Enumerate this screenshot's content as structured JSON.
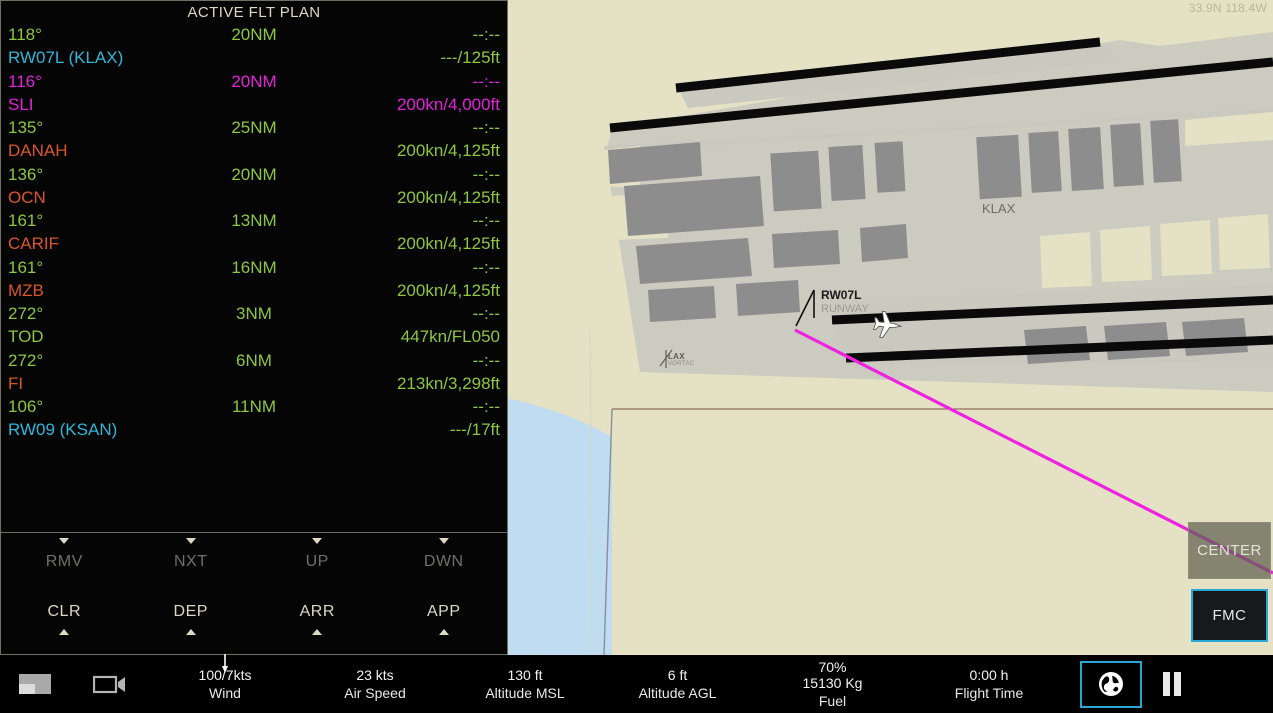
{
  "map": {
    "coordinates": "33.9N 118.4W",
    "labels": {
      "airport": "KLAX",
      "runway_id": "RW07L",
      "runway_sub": "RUNWAY",
      "navaid": "LAX",
      "navaid_sub": "VORTAC"
    },
    "colors": {
      "land": "#e4e1c4",
      "water": "#bfdcf0",
      "runway": "#0a0a0a",
      "apron": "#c9c9c0",
      "building": "#8d8d8d",
      "course_line": "#ee22e0",
      "border_line": "#6b4a3a"
    },
    "buttons": {
      "center": "CENTER",
      "fmc": "FMC"
    }
  },
  "flight_plan": {
    "title": "ACTIVE FLT PLAN",
    "colors": {
      "green": "#8dc63f",
      "cyan": "#2fb6d8",
      "magenta": "#e224d8",
      "orange": "#d8562a",
      "cream": "#ded8c4",
      "dim": "#6f6f6d"
    },
    "legs": [
      {
        "course": "118°",
        "distance": "20NM",
        "eta": "--:--",
        "name": "RW07L (KLAX)",
        "speed_alt": "---/125ft",
        "course_color": "green",
        "dist_color": "green",
        "eta_color": "green",
        "name_color": "cyan",
        "speed_color": "green"
      },
      {
        "course": "116°",
        "distance": "20NM",
        "eta": "--:--",
        "name": "SLI",
        "speed_alt": "200kn/4,000ft",
        "course_color": "magenta",
        "dist_color": "magenta",
        "eta_color": "magenta",
        "name_color": "magenta",
        "speed_color": "magenta"
      },
      {
        "course": "135°",
        "distance": "25NM",
        "eta": "--:--",
        "name": "DANAH",
        "speed_alt": "200kn/4,125ft",
        "course_color": "green",
        "dist_color": "green",
        "eta_color": "green",
        "name_color": "orange",
        "speed_color": "green"
      },
      {
        "course": "136°",
        "distance": "20NM",
        "eta": "--:--",
        "name": "OCN",
        "speed_alt": "200kn/4,125ft",
        "course_color": "green",
        "dist_color": "green",
        "eta_color": "green",
        "name_color": "orange",
        "speed_color": "green"
      },
      {
        "course": "161°",
        "distance": "13NM",
        "eta": "--:--",
        "name": "CARIF",
        "speed_alt": "200kn/4,125ft",
        "course_color": "green",
        "dist_color": "green",
        "eta_color": "green",
        "name_color": "orange",
        "speed_color": "green"
      },
      {
        "course": "161°",
        "distance": "16NM",
        "eta": "--:--",
        "name": "MZB",
        "speed_alt": "200kn/4,125ft",
        "course_color": "green",
        "dist_color": "green",
        "eta_color": "green",
        "name_color": "orange",
        "speed_color": "green"
      },
      {
        "course": "272°",
        "distance": "3NM",
        "eta": "--:--",
        "name": "TOD",
        "speed_alt": "447kn/FL050",
        "course_color": "green",
        "dist_color": "green",
        "eta_color": "green",
        "name_color": "green",
        "speed_color": "green"
      },
      {
        "course": "272°",
        "distance": "6NM",
        "eta": "--:--",
        "name": "FI",
        "speed_alt": "213kn/3,298ft",
        "course_color": "green",
        "dist_color": "green",
        "eta_color": "green",
        "name_color": "orange",
        "speed_color": "green"
      },
      {
        "course": "106°",
        "distance": "11NM",
        "eta": "--:--",
        "name": "RW09 (KSAN)",
        "speed_alt": "---/17ft",
        "course_color": "green",
        "dist_color": "green",
        "eta_color": "green",
        "name_color": "cyan",
        "speed_color": "green"
      }
    ],
    "keys_top": [
      "RMV",
      "NXT",
      "UP",
      "DWN"
    ],
    "keys_bottom": [
      "CLR",
      "DEP",
      "ARR",
      "APP"
    ]
  },
  "status_bar": {
    "wind": {
      "value": "100/7kts",
      "label": "Wind"
    },
    "air_speed": {
      "value": "23 kts",
      "label": "Air Speed"
    },
    "altitude_msl": {
      "value": "130 ft",
      "label": "Altitude MSL"
    },
    "altitude_agl": {
      "value": "6 ft",
      "label": "Altitude AGL"
    },
    "fuel": {
      "value": "70%",
      "value2": "15130 Kg",
      "label": "Fuel"
    },
    "flight_time": {
      "value": "0:00 h",
      "label": "Flight Time"
    },
    "icons": {
      "layout": "layout-panel-icon",
      "camera": "video-camera-icon",
      "globe": "globe-icon",
      "pause": "pause-icon"
    }
  }
}
